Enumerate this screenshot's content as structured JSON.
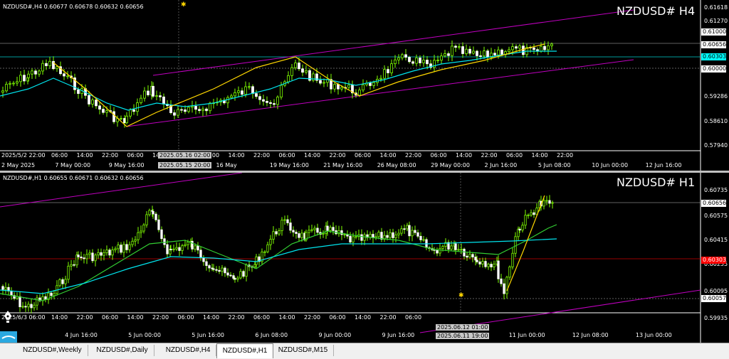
{
  "top": {
    "header": "NZDUSD#,H4  0.60677 0.60678 0.60632 0.60656",
    "title": "NZDUSD# H4",
    "price_ticks": [
      "0.61618",
      "0.61270",
      "0.61000",
      "0.60656",
      "0.60303",
      "0.60000",
      "0.59286",
      "0.58610",
      "0.57940"
    ],
    "time_ticks": [
      "2 May 2025",
      "7 May 00:00",
      "9 May 16:00",
      "14 May 08:00",
      "16 May",
      "19 May 16:00",
      "21 May 16:00",
      "26 May 08:00",
      "29 May 00:00",
      "2 Jun 16:00",
      "5 Jun 08:00",
      "10 Jun 00:00",
      "12 Jun 16:00"
    ],
    "subtime_ticks": [
      "2025/5/2 22:00",
      "06:00",
      "14:00",
      "22:00",
      "06:00",
      "14:00",
      "22:00",
      "06:00",
      "14:00",
      "22:00",
      "06:00",
      "14:00",
      "22:00",
      "06:00",
      "14:00",
      "22:00",
      "06:00",
      "14:00",
      "22:00",
      "06:00",
      "14:00",
      "22:00"
    ],
    "crosshair_time_1": "2025.05.16 02:00",
    "crosshair_time_2": "2025.05.15 20:00",
    "colors": {
      "current": "#ffffff",
      "cyan_level": "#00ffff"
    }
  },
  "bottom": {
    "header": "NZDUSD#,H1  0.60655 0.60671 0.60632 0.60656",
    "title": "NZDUSD# H1",
    "price_ticks": [
      "0.60735",
      "0.60656",
      "0.60575",
      "0.60415",
      "0.60255",
      "0.60095",
      "0.60057",
      "0.59935"
    ],
    "red_level": "0.60303",
    "time_ticks": [
      "2025",
      "4 Jun 16:00",
      "5 Jun 00:00",
      "5 Jun 16:00",
      "6 Jun 08:00",
      "9 Jun 00:00",
      "9 Jun 16:00",
      "10 Jun 08:00",
      "11 Jun 00:00",
      "12 Jun 08:00",
      "13 Jun 00:00"
    ],
    "subtime_ticks": [
      "2025/6/3 06:00",
      "14:00",
      "22:00",
      "06:00",
      "14:00",
      "22:00",
      "06:00",
      "14:00",
      "22:00",
      "06:00",
      "14:00",
      "22:00",
      "06:00",
      "14:00",
      "22:00",
      "06:00"
    ],
    "crosshair_time_1": "2025.06.12 01:00",
    "crosshair_time_2": "2025.06.11 19:00",
    "colors": {
      "red_level": "#ff0000"
    }
  },
  "tabs": [
    {
      "label": "NZDUSD#,Weekly",
      "active": false
    },
    {
      "label": "NZDUSD#,Daily",
      "active": false
    },
    {
      "label": "NZDUSD#,H4",
      "active": false
    },
    {
      "label": "NZDUSD#,H1",
      "active": true
    },
    {
      "label": "NZDUSD#,M15",
      "active": false
    }
  ]
}
